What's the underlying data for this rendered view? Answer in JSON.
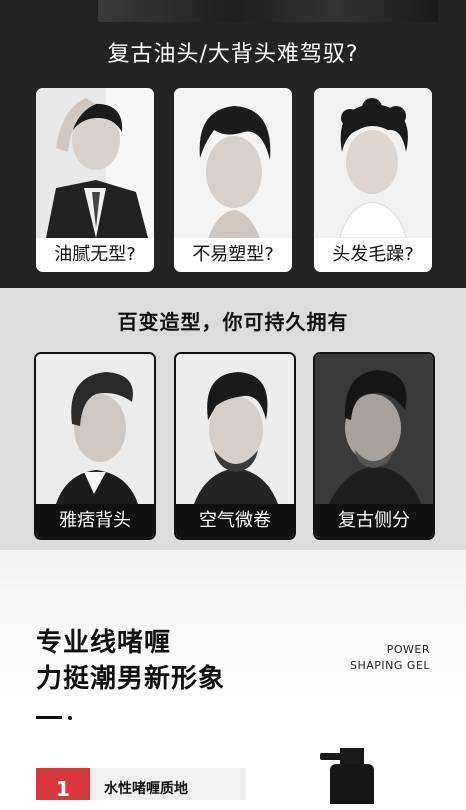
{
  "problems": {
    "title": "复古油头/大背头难驾驭?",
    "cards": [
      {
        "label": "油腻无型?"
      },
      {
        "label": "不易塑型?"
      },
      {
        "label": "头发毛躁?"
      }
    ]
  },
  "styles": {
    "title": "百变造型，你可持久拥有",
    "cards": [
      {
        "label": "雅痞背头"
      },
      {
        "label": "空气微卷"
      },
      {
        "label": "复古侧分"
      }
    ]
  },
  "product": {
    "headline_1": "专业线啫喱",
    "headline_2": "力挺潮男新形象",
    "english_1": "POWER",
    "english_2": "SHAPING GEL",
    "feature": {
      "number": "1",
      "text": "水性啫喱质地"
    }
  },
  "colors": {
    "dark": "#242424",
    "gray": "#dcdcdc",
    "accent": "#d9383a"
  }
}
